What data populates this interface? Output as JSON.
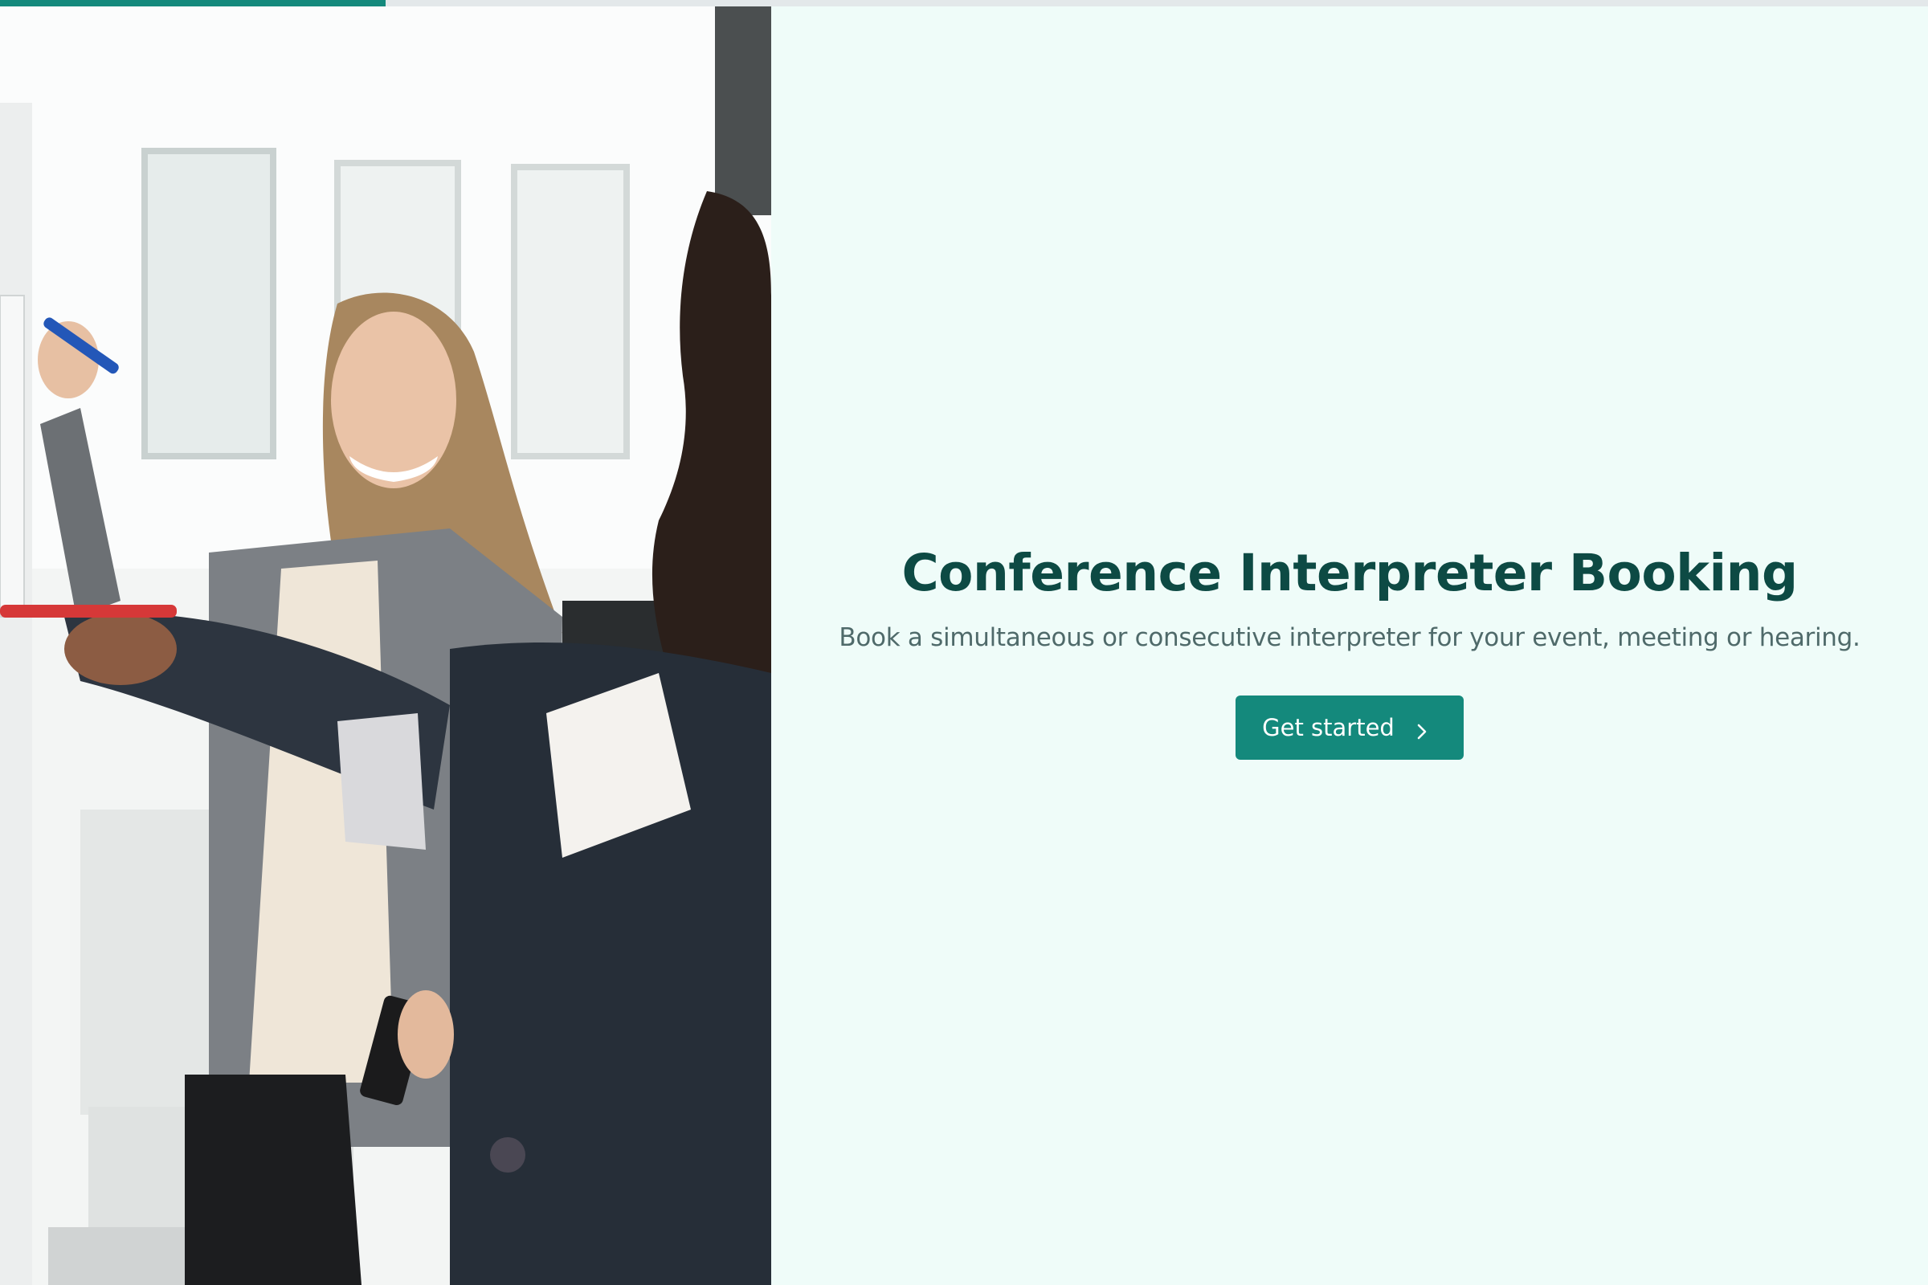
{
  "progress": {
    "fraction": 0.2
  },
  "hero": {
    "image": "people-whiteboard-photo"
  },
  "main": {
    "title": "Conference Interpreter Booking",
    "subtitle": "Book a simultaneous or consecutive interpreter for your event, meeting or hearing.",
    "cta_label": "Get started",
    "cta_icon": "chevron-right-icon"
  },
  "colors": {
    "accent": "#14897c",
    "title": "#0d4a44",
    "subtitle": "#4f6a6a",
    "background": "#effcf9"
  }
}
